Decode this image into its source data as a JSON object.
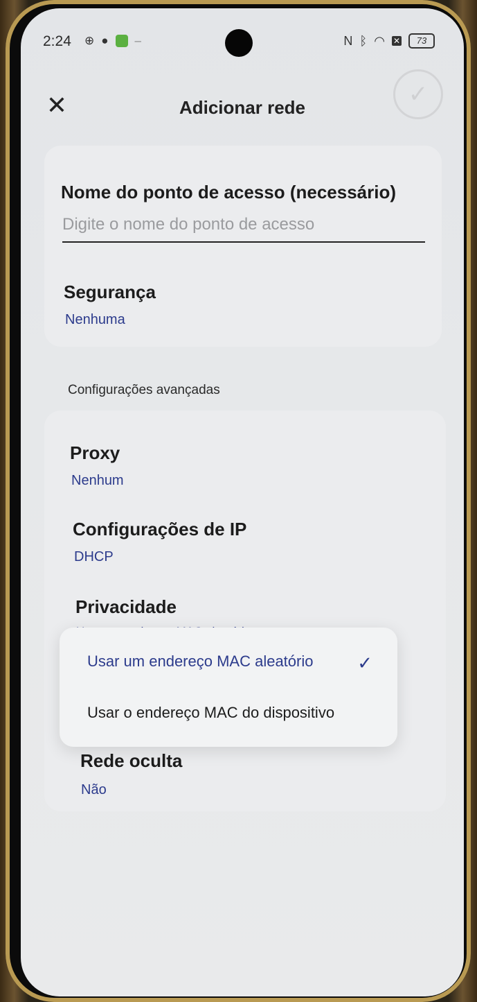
{
  "status_bar": {
    "time": "2:24",
    "battery": "73"
  },
  "header": {
    "title": "Adicionar rede",
    "close_glyph": "✕",
    "confirm_glyph": "✓"
  },
  "access_point": {
    "label": "Nome do ponto de acesso (necessário)",
    "placeholder": "Digite o nome do ponto de acesso"
  },
  "security": {
    "label": "Segurança",
    "value": "Nenhuma"
  },
  "advanced": {
    "section_title": "Configurações avançadas",
    "proxy": {
      "label": "Proxy",
      "value": "Nenhum"
    },
    "ip_settings": {
      "label": "Configurações de IP",
      "value": "DHCP"
    },
    "privacy": {
      "label": "Privacidade",
      "value": "Usar um endereço MAC aleatório"
    },
    "hidden_network": {
      "label": "Rede oculta",
      "value": "Não"
    }
  },
  "privacy_dropdown": {
    "options": [
      {
        "label": "Usar um endereço MAC aleatório",
        "selected": true
      },
      {
        "label": "Usar o endereço MAC do dispositivo",
        "selected": false
      }
    ]
  },
  "colors": {
    "accent": "#2c3b8c",
    "screen_bg": "#e6e8ea",
    "frame_gold": "#b99a52"
  },
  "icons": {
    "status_left": [
      "target-icon",
      "shield-icon",
      "green-app-icon",
      "dash-icon"
    ],
    "status_right": [
      "nfc-icon",
      "bluetooth-icon",
      "wifi-icon",
      "sim-icon",
      "battery-icon"
    ]
  }
}
